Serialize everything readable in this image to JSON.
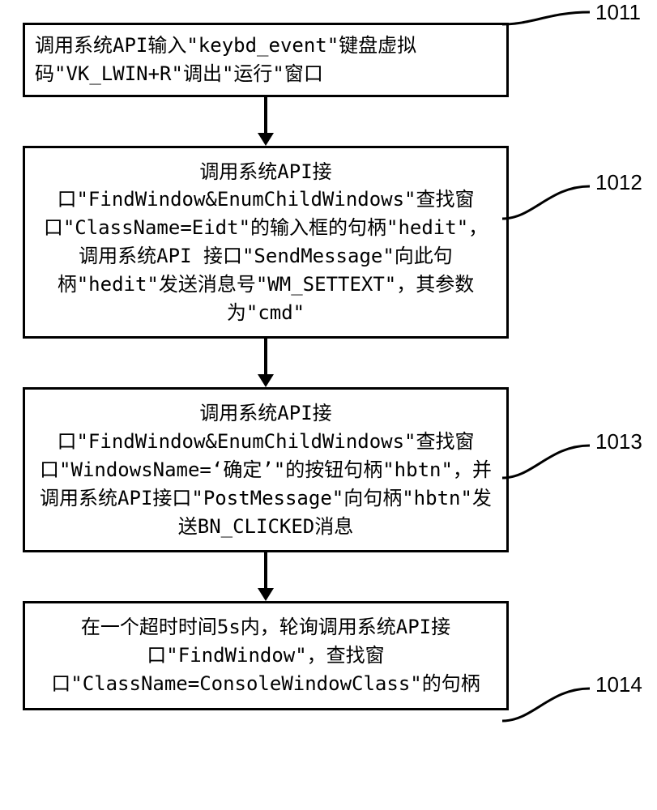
{
  "flowchart": {
    "boxes": [
      {
        "id": 1011,
        "label": "1011",
        "text": "调用系统API输入\"keybd_event\"键盘虚拟码\"VK_LWIN+R\"调出\"运行\"窗口"
      },
      {
        "id": 1012,
        "label": "1012",
        "text": "调用系统API接口\"FindWindow&EnumChildWindows\"查找窗口\"ClassName=Eidt\"的输入框的句柄\"hedit\"，调用系统API 接口\"SendMessage\"向此句柄\"hedit\"发送消息号\"WM_SETTEXT\"，其参数为\"cmd\""
      },
      {
        "id": 1013,
        "label": "1013",
        "text": "调用系统API接口\"FindWindow&EnumChildWindows\"查找窗口\"WindowsName=‘确定’\"的按钮句柄\"hbtn\"，并调用系统API接口\"PostMessage\"向句柄\"hbtn\"发送BN_CLICKED消息"
      },
      {
        "id": 1014,
        "label": "1014",
        "text": "在一个超时时间5s内，轮询调用系统API接口\"FindWindow\"，查找窗口\"ClassName=ConsoleWindowClass\"的句柄"
      }
    ]
  },
  "chart_data": {
    "type": "flowchart",
    "direction": "top-to-bottom",
    "nodes": [
      {
        "id": "1011",
        "text": "调用系统API输入\"keybd_event\"键盘虚拟码\"VK_LWIN+R\"调出\"运行\"窗口"
      },
      {
        "id": "1012",
        "text": "调用系统API接口\"FindWindow&EnumChildWindows\"查找窗口\"ClassName=Eidt\"的输入框的句柄\"hedit\"，调用系统API 接口\"SendMessage\"向此句柄\"hedit\"发送消息号\"WM_SETTEXT\"，其参数为\"cmd\""
      },
      {
        "id": "1013",
        "text": "调用系统API接口\"FindWindow&EnumChildWindows\"查找窗口\"WindowsName='确定'\"的按钮句柄\"hbtn\"，并调用系统API接口\"PostMessage\"向句柄\"hbtn\"发送BN_CLICKED消息"
      },
      {
        "id": "1014",
        "text": "在一个超时时间5s内，轮询调用系统API接口\"FindWindow\"，查找窗口\"ClassName=ConsoleWindowClass\"的句柄"
      }
    ],
    "edges": [
      {
        "from": "1011",
        "to": "1012"
      },
      {
        "from": "1012",
        "to": "1013"
      },
      {
        "from": "1013",
        "to": "1014"
      }
    ]
  }
}
